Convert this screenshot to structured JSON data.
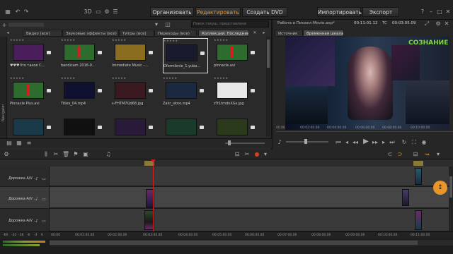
{
  "topbar": {
    "tabs": [
      "Организовать",
      "Редактировать",
      "Создать DVD"
    ],
    "active_tab": "Редактировать",
    "import_label": "Импортировать",
    "export_label": "Экспорт",
    "mode_label": "3D"
  },
  "library": {
    "tabs": [
      "Видео (все)",
      "Звуковые эффекты (все)",
      "Титры (все)",
      "Переходы (все)",
      "Коллекции: Последний..."
    ],
    "active_tab_index": 4,
    "search_placeholder": "Поиск текущ. представлени",
    "side_label": "Navigator",
    "items": [
      {
        "caption": "♥♥♥Что такое С...",
        "stars": "★★★★★",
        "color": "#4a1e5a"
      },
      {
        "caption": "bandicam 2016-0...",
        "stars": "★★★★★",
        "color": "#2e6b2e"
      },
      {
        "caption": "Immediate Music -...",
        "stars": "★★★★★",
        "color": "#8a6d1e"
      },
      {
        "caption": "Oformlenie_1.yuba...",
        "stars": "★★★★★",
        "color": "#1a1a2e"
      },
      {
        "caption": "pinnacle.avi",
        "stars": "★★★★★",
        "color": "#2e6b2e"
      },
      {
        "caption": "Pinnacle Plus.avi",
        "stars": "★★★★★",
        "color": "#2e6b2e"
      },
      {
        "caption": "Titles_04.mp4",
        "stars": "★★★★★",
        "color": "#101030"
      },
      {
        "caption": "s-FHTM7Qd68.jpg",
        "stars": "★★★★★",
        "color": "#3a1a20"
      },
      {
        "caption": "Zakr_okno.mp4",
        "stars": "★★★★★",
        "color": "#1a2840"
      },
      {
        "caption": "zTr1tmdnXGs.jpg",
        "stars": "★★★★★",
        "color": "#e8e8e8"
      },
      {
        "caption": "",
        "stars": "",
        "color": "#1a3a4a"
      },
      {
        "caption": "",
        "stars": "",
        "color": "#101010"
      },
      {
        "caption": "",
        "stars": "",
        "color": "#2a1a3a"
      },
      {
        "caption": "",
        "stars": "",
        "color": "#1a3a2a"
      },
      {
        "caption": "",
        "stars": "",
        "color": "#2a3a1a"
      }
    ]
  },
  "player": {
    "title": "Работа в Пинакл.Movie.axp*",
    "tabs": [
      "Источник",
      "Временная шкала"
    ],
    "active_tab": "Временная шкала",
    "timecode": "00:11:01.12",
    "tc_label": "TC",
    "duration": "00:03:05.09",
    "overlay_text": "СОЗНАНИЕ",
    "scrub_ticks": [
      "00.00",
      "00:02:00.00",
      "00:04:00.00",
      "00:06:00.00",
      "00:08:00.00",
      "00:10:00.00"
    ]
  },
  "timeline": {
    "tracks": [
      {
        "label": "Дорожка А/V ..."
      },
      {
        "label": "Дорожка А/V ..."
      },
      {
        "label": "Дорожка А/V ..."
      }
    ],
    "ruler_ticks": [
      "-60",
      "-22",
      "-16",
      "-6",
      "-3",
      "0",
      "00:00",
      "00:01:00.00",
      "00:02:00.00",
      "00:03:00.00",
      "00:04:00.00",
      "00:05:00.00",
      "00:06:00.00",
      "00:07:00.00",
      "00:08:00.00",
      "00:09:00.00",
      "00:10:00.00",
      "00:11:00.00"
    ]
  },
  "colors": {
    "accent": "#e8952a",
    "playhead": "#d02020"
  }
}
